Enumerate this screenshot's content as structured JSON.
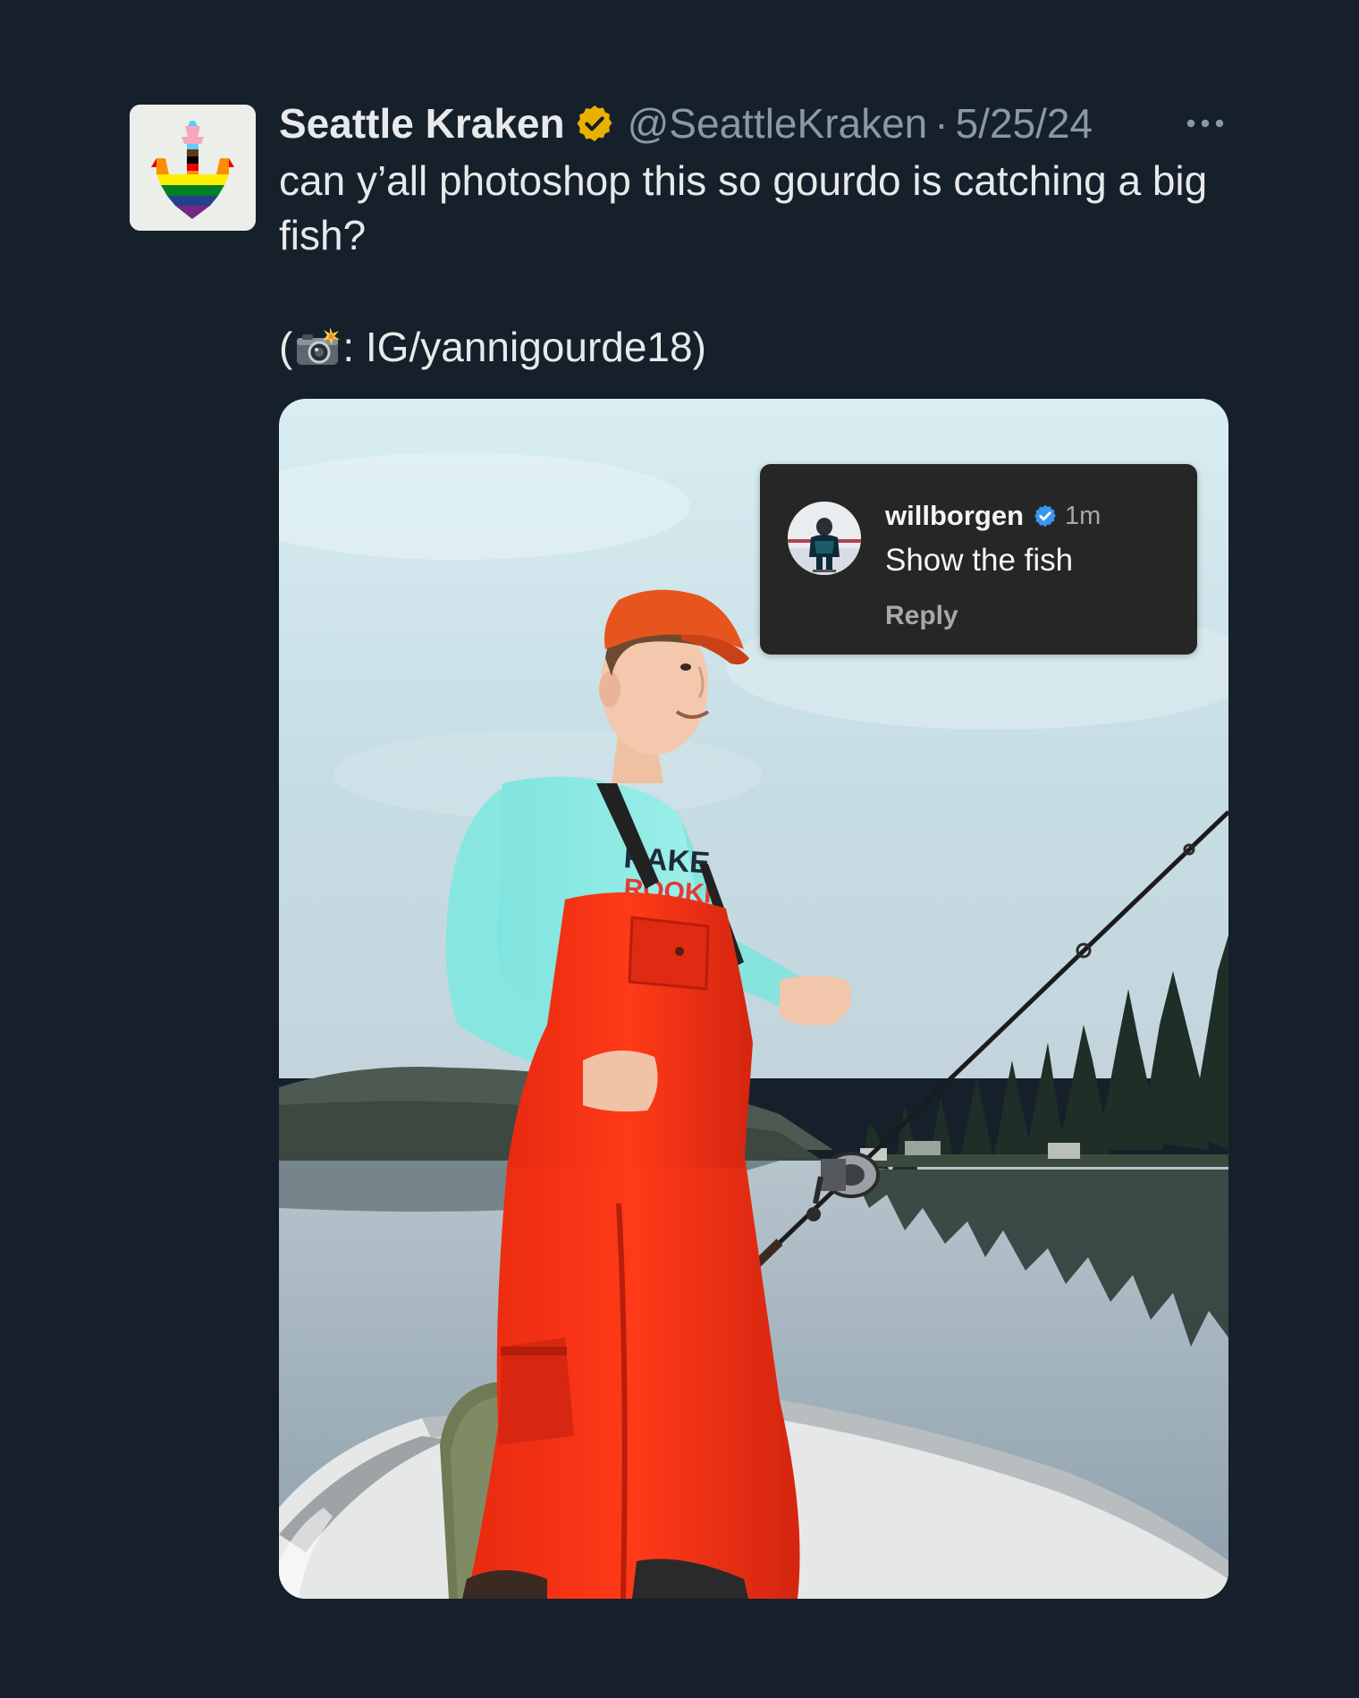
{
  "tweet": {
    "display_name": "Seattle Kraken",
    "handle": "@SeattleKraken",
    "separator": "·",
    "date": "5/25/24",
    "text_line": "can y’all photoshop this so gourdo is catching a big fish?",
    "credit_prefix": "(",
    "credit_suffix": ": IG/yannigourde18)",
    "verified_color": "#e8b100",
    "camera_emoji": "📸"
  },
  "media": {
    "comment": {
      "username": "willborgen",
      "time": "1m",
      "text": "Show the fish",
      "reply_label": "Reply",
      "verified_color": "#3897f0"
    }
  },
  "theme": {
    "background": "#15202b",
    "text_primary": "#e7e9ea",
    "text_secondary": "#8b98a5"
  },
  "icons": {
    "avatar": "kraken-pride-anchor-logo",
    "more": "more-horizontal-icon",
    "verified": "verified-badge-icon",
    "camera": "camera-flash-emoji"
  }
}
